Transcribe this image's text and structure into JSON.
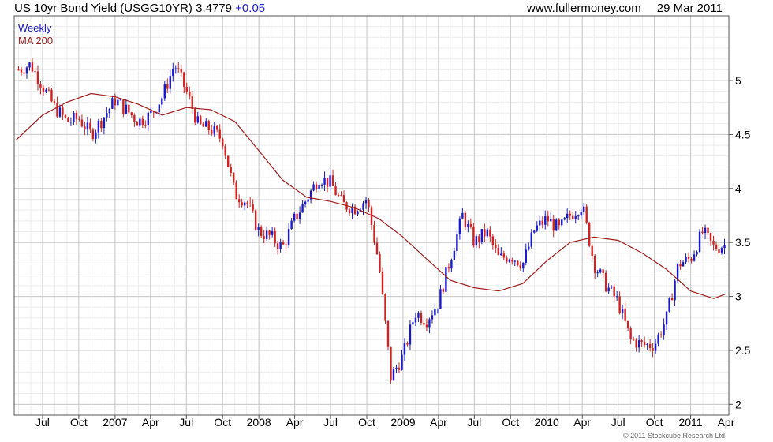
{
  "header": {
    "title": "US 10yr Bond Yield (USGG10YR)",
    "last_value": "3.4779",
    "change": "+0.05",
    "site": "www.fullermoney.com",
    "date": "29 Mar 2011"
  },
  "footer": {
    "copyright": "© 2011 Stockcube Research Ltd"
  },
  "colors": {
    "up_candle": "#1a1acc",
    "down_candle": "#d42020",
    "ma_line": "#a01c1c",
    "grid": "#dcdcdc"
  },
  "chart_data": {
    "type": "line",
    "legend": [
      "Weekly",
      "MA 200"
    ],
    "legend_placement": "top-left",
    "y_axis_side": "right",
    "grid": true,
    "ylim": [
      1.9,
      5.6
    ],
    "y_ticks": [
      2,
      2.5,
      3,
      3.5,
      4,
      4.5,
      5
    ],
    "y_tick_labels": [
      "2",
      "2.5",
      "3",
      "3.5",
      "4",
      "4.5",
      "5"
    ],
    "x_tick_labels": [
      "Jul",
      "Oct",
      "2007",
      "Apr",
      "Jul",
      "Oct",
      "2008",
      "Apr",
      "Jul",
      "Oct",
      "2009",
      "Apr",
      "Jul",
      "Oct",
      "2010",
      "Apr",
      "Jul",
      "Oct",
      "2011",
      "Apr"
    ],
    "x_tick_dates": [
      "2006-07-01",
      "2006-10-01",
      "2007-01-01",
      "2007-04-01",
      "2007-07-01",
      "2007-10-01",
      "2008-01-01",
      "2008-04-01",
      "2008-07-01",
      "2008-10-01",
      "2009-01-01",
      "2009-04-01",
      "2009-07-01",
      "2009-10-01",
      "2010-01-01",
      "2010-04-01",
      "2010-07-01",
      "2010-10-01",
      "2011-01-01",
      "2011-04-01"
    ],
    "x_range": [
      "2006-04-20",
      "2011-04-08"
    ],
    "series": [
      {
        "name": "Weekly",
        "style": "candlestick",
        "x": [
          "2006-05-01",
          "2006-06-01",
          "2006-07-01",
          "2006-08-01",
          "2006-09-01",
          "2006-10-01",
          "2006-11-01",
          "2006-12-01",
          "2007-01-01",
          "2007-02-01",
          "2007-03-01",
          "2007-04-01",
          "2007-05-01",
          "2007-06-01",
          "2007-07-01",
          "2007-08-01",
          "2007-09-01",
          "2007-10-01",
          "2007-11-01",
          "2007-12-01",
          "2008-01-01",
          "2008-02-01",
          "2008-03-01",
          "2008-04-01",
          "2008-05-01",
          "2008-06-01",
          "2008-07-01",
          "2008-08-01",
          "2008-09-01",
          "2008-10-01",
          "2008-11-01",
          "2008-12-01",
          "2009-01-01",
          "2009-02-01",
          "2009-03-01",
          "2009-04-01",
          "2009-05-01",
          "2009-06-01",
          "2009-07-01",
          "2009-08-01",
          "2009-09-01",
          "2009-10-01",
          "2009-11-01",
          "2009-12-01",
          "2010-01-01",
          "2010-02-01",
          "2010-03-01",
          "2010-04-01",
          "2010-05-01",
          "2010-06-01",
          "2010-07-01",
          "2010-08-01",
          "2010-09-01",
          "2010-10-01",
          "2010-11-01",
          "2010-12-01",
          "2011-01-01",
          "2011-02-01",
          "2011-03-01",
          "2011-03-29"
        ],
        "values": [
          5.1,
          5.15,
          4.95,
          4.75,
          4.62,
          4.65,
          4.5,
          4.65,
          4.82,
          4.72,
          4.62,
          4.68,
          4.85,
          5.15,
          4.9,
          4.58,
          4.55,
          4.45,
          3.95,
          3.88,
          3.6,
          3.55,
          3.45,
          3.72,
          3.9,
          4.1,
          4.05,
          3.85,
          3.82,
          3.9,
          3.3,
          2.25,
          2.45,
          2.85,
          2.78,
          2.95,
          3.35,
          3.75,
          3.5,
          3.6,
          3.35,
          3.38,
          3.3,
          3.62,
          3.72,
          3.62,
          3.75,
          3.85,
          3.3,
          3.1,
          2.95,
          2.6,
          2.55,
          2.55,
          2.8,
          3.3,
          3.35,
          3.6,
          3.45,
          3.478
        ]
      },
      {
        "name": "MA 200",
        "style": "line",
        "x": [
          "2006-04-25",
          "2006-07-01",
          "2006-09-01",
          "2006-11-01",
          "2007-01-01",
          "2007-03-01",
          "2007-05-01",
          "2007-07-01",
          "2007-09-01",
          "2007-11-01",
          "2008-01-01",
          "2008-03-01",
          "2008-05-01",
          "2008-07-01",
          "2008-09-01",
          "2008-11-01",
          "2009-01-01",
          "2009-03-01",
          "2009-05-01",
          "2009-07-01",
          "2009-09-01",
          "2009-11-01",
          "2010-01-01",
          "2010-03-01",
          "2010-05-01",
          "2010-07-01",
          "2010-09-01",
          "2010-11-01",
          "2011-01-01",
          "2011-03-01",
          "2011-03-29"
        ],
        "values": [
          4.45,
          4.68,
          4.8,
          4.88,
          4.85,
          4.78,
          4.68,
          4.75,
          4.73,
          4.62,
          4.35,
          4.08,
          3.92,
          3.88,
          3.82,
          3.72,
          3.55,
          3.35,
          3.15,
          3.08,
          3.05,
          3.12,
          3.33,
          3.5,
          3.55,
          3.52,
          3.4,
          3.25,
          3.05,
          2.98,
          3.02
        ]
      }
    ]
  }
}
